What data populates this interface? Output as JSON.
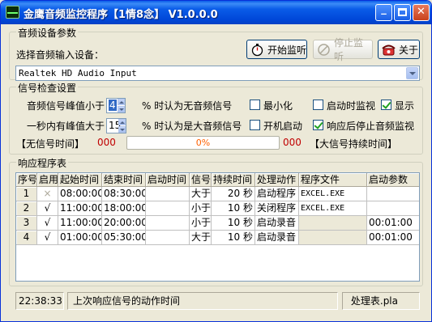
{
  "window": {
    "title": "金鹰音频监控程序【1情8念】 V1.0.0.0",
    "minimize_label": "_",
    "close_label": "✕"
  },
  "device": {
    "group_title": "音频设备参数",
    "select_label": "选择音频输入设备：",
    "selected_device": "Realtek HD Audio Input",
    "start_button": "开始监听",
    "stop_button": "停止监听",
    "about_button": "关于"
  },
  "signal": {
    "group_title": "信号检查设置",
    "peak_label": "音频信号峰值小于",
    "peak_value": "4",
    "peak_suffix": "% 时认为无音频信号",
    "count_label": "一秒内有峰值大于",
    "count_value": "15",
    "count_suffix": "% 时认为是大音频信号",
    "no_signal_time_label": "【无信号时间】",
    "no_signal_time_value": "000",
    "progress_text": "0%",
    "progress_value": 0,
    "big_signal_value": "000",
    "big_signal_time_label": "【大信号持续时间】",
    "checkboxes": {
      "minimize": {
        "label": "最小化",
        "checked": false
      },
      "start_monitor": {
        "label": "启动时监视",
        "checked": false
      },
      "display": {
        "label": "显示",
        "checked": true
      },
      "autostart": {
        "label": "开机启动",
        "checked": false
      },
      "stop_after": {
        "label": "响应后停止音频监视",
        "checked": true
      }
    }
  },
  "response": {
    "group_title": "响应程序表",
    "columns": [
      "序号",
      "启用",
      "起始时间",
      "结束时间",
      "启动时间",
      "信号",
      "持续时间",
      "处理动作",
      "程序文件",
      "启动参数"
    ],
    "rows": [
      {
        "no": "1",
        "enabled": "×",
        "start": "08:00:00",
        "end": "08:30:00",
        "launch": "",
        "signal": "大于",
        "duration": "20 秒",
        "action": "启动程序",
        "file": "EXCEL.EXE",
        "params": ""
      },
      {
        "no": "2",
        "enabled": "√",
        "start": "11:00:00",
        "end": "18:00:00",
        "launch": "",
        "signal": "小于",
        "duration": "10 秒",
        "action": "关闭程序",
        "file": "EXCEL.EXE",
        "params": ""
      },
      {
        "no": "3",
        "enabled": "√",
        "start": "11:00:00",
        "end": "20:00:00",
        "launch": "",
        "signal": "小于",
        "duration": "10 秒",
        "action": "启动录音",
        "file": "",
        "params": "00:01:00"
      },
      {
        "no": "4",
        "enabled": "√",
        "start": "01:00:00",
        "end": "05:30:00",
        "launch": "",
        "signal": "大于",
        "duration": "10 秒",
        "action": "启动录音",
        "file": "",
        "params": "00:01:00"
      }
    ]
  },
  "status": {
    "time": "22:38:33",
    "message": "上次响应信号的动作时间",
    "file": "处理表.pla"
  },
  "colors": {
    "title_bar": "#0a5ce8",
    "counter_red": "#c00000",
    "progress_text": "#ff6000",
    "window_bg": "#ece9d8"
  }
}
